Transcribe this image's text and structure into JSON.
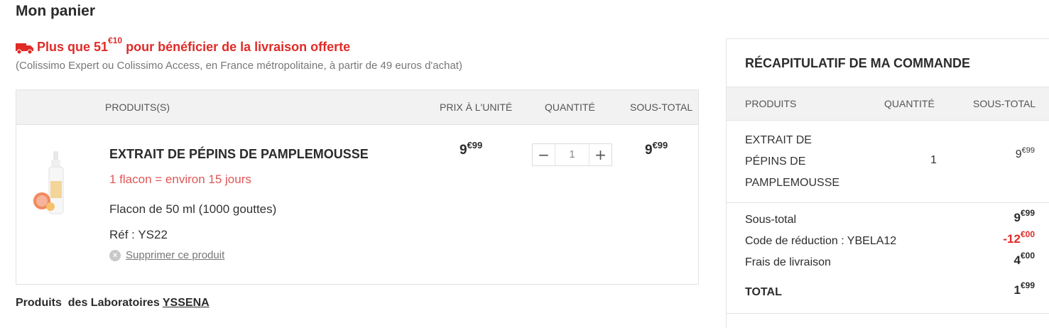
{
  "page": {
    "title": "Mon panier"
  },
  "shipping": {
    "main_prefix": "Plus que 51",
    "main_cents": "€10",
    "main_suffix": " pour bénéficier de la livraison offerte",
    "sub": "(Colissimo Expert ou Colissimo Access, en France métropolitaine, à partir de 49 euros d'achat)",
    "color": "#e02b27"
  },
  "cart": {
    "headers": [
      "PRODUITS(S)",
      "PRIX À L'UNITÉ",
      "QUANTITÉ",
      "SOUS-TOTAL"
    ],
    "item": {
      "name": "EXTRAIT DE PÉPINS DE PAMPLEMOUSSE",
      "note": "1 flacon = environ 15 jours",
      "volume": "Flacon de 50 ml (1000 gouttes)",
      "ref": "Réf : YS22",
      "remove_label": "Supprimer ce produit",
      "unit_price_int": "9",
      "unit_price_cents": "€99",
      "quantity": "1",
      "subtotal_int": "9",
      "subtotal_cents": "€99",
      "minus": "−",
      "plus": "+"
    }
  },
  "brand": {
    "prefix": "Produits  des Laboratoires ",
    "name": "YSSENA"
  },
  "summary": {
    "title": "RÉCAPITULATIF DE MA COMMANDE",
    "headers": [
      "PRODUITS",
      "QUANTITÉ",
      "SOUS-TOTAL"
    ],
    "item": {
      "name_line1": "EXTRAIT DE",
      "name_line2": "PÉPINS DE",
      "name_line3": "PAMPLEMOUSSE",
      "quantity": "1",
      "price_int": "9",
      "price_cents": "€99"
    },
    "totals": {
      "subtotal_label": "Sous-total",
      "subtotal_int": "9",
      "subtotal_cents": "€99",
      "discount_label": "Code de réduction : YBELA12",
      "discount_int": "-12",
      "discount_cents": "€00",
      "shipping_label": "Frais de livraison",
      "shipping_int": "4",
      "shipping_cents": "€00",
      "total_label": "TOTAL",
      "total_int": "1",
      "total_cents": "€99"
    }
  }
}
